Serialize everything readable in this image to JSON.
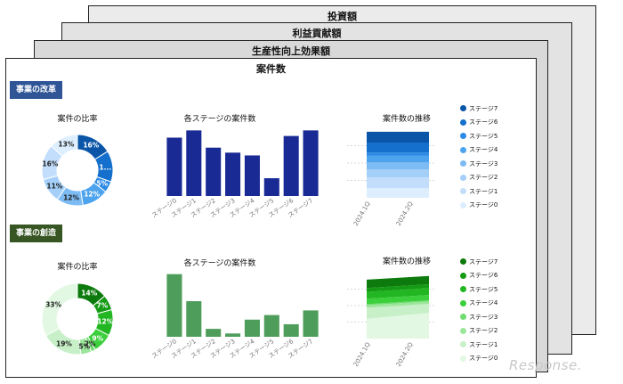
{
  "sheets": {
    "back3": "投資額",
    "back2": "利益貢献額",
    "back1": "生産性向上効果額",
    "front": "案件数"
  },
  "reform": {
    "section_label": "事業の改革",
    "donut_title": "案件の比率",
    "bar_title": "各ステージの案件数",
    "area_title": "案件数の推移"
  },
  "creation": {
    "section_label": "事業の創造",
    "donut_title": "案件の比率",
    "bar_title": "各ステージの案件数",
    "area_title": "案件数の推移"
  },
  "stages": [
    "ステージ0",
    "ステージ1",
    "ステージ2",
    "ステージ3",
    "ステージ4",
    "ステージ5",
    "ステージ6",
    "ステージ7"
  ],
  "legend_order": [
    "ステージ7",
    "ステージ6",
    "ステージ5",
    "ステージ4",
    "ステージ3",
    "ステージ2",
    "ステージ1",
    "ステージ0"
  ],
  "blue_palette": [
    "#ddeeff",
    "#c2defc",
    "#a3cff8",
    "#7cbbf3",
    "#4ea3ee",
    "#2c8ae6",
    "#1470cc",
    "#0a55a8"
  ],
  "green_palette": [
    "#e2f8e2",
    "#c8f0c8",
    "#9be69b",
    "#6fdc6f",
    "#3ccf3c",
    "#22b722",
    "#149a14",
    "#0c7a0c"
  ],
  "bar_color_reform": "#1a2a94",
  "bar_color_creation": "#4f9d5a",
  "area_xticks": [
    "2024.1Q",
    "2024.2Q"
  ],
  "watermark": "Response.",
  "chart_data": [
    {
      "type": "pie",
      "section": "事業の改革",
      "title": "案件の比率",
      "labels": [
        "16%",
        "1...",
        "5%",
        "12%",
        "12%",
        "11%",
        "16%",
        "13%"
      ],
      "values": [
        16,
        14,
        5,
        12,
        12,
        11,
        16,
        13
      ],
      "colors": [
        "#0a55a8",
        "#1470cc",
        "#2c8ae6",
        "#4ea3ee",
        "#7cbbf3",
        "#a3cff8",
        "#c2defc",
        "#ddeeff"
      ]
    },
    {
      "type": "bar",
      "section": "事業の改革",
      "title": "各ステージの案件数",
      "categories": [
        "ステージ0",
        "ステージ1",
        "ステージ2",
        "ステージ3",
        "ステージ4",
        "ステージ5",
        "ステージ6",
        "ステージ7"
      ],
      "values": [
        10.5,
        11.8,
        8.7,
        7.8,
        7.3,
        3.2,
        10.8,
        11.8
      ],
      "ylim": [
        0,
        12.5
      ]
    },
    {
      "type": "area",
      "section": "事業の改革",
      "title": "案件数の推移",
      "x": [
        "2024.1Q",
        "2024.2Q"
      ],
      "series": [
        {
          "name": "ステージ0",
          "values": [
            10.5,
            10.5
          ]
        },
        {
          "name": "ステージ1",
          "values": [
            11.8,
            11.8
          ]
        },
        {
          "name": "ステージ2",
          "values": [
            8.7,
            8.7
          ]
        },
        {
          "name": "ステージ3",
          "values": [
            7.8,
            7.8
          ]
        },
        {
          "name": "ステージ4",
          "values": [
            7.3,
            7.3
          ]
        },
        {
          "name": "ステージ5",
          "values": [
            3.2,
            3.2
          ]
        },
        {
          "name": "ステージ6",
          "values": [
            10.8,
            10.8
          ]
        },
        {
          "name": "ステージ7",
          "values": [
            11.8,
            11.8
          ]
        }
      ]
    },
    {
      "type": "pie",
      "section": "事業の創造",
      "title": "案件の比率",
      "labels": [
        "14%",
        "7%",
        "12%",
        "9%",
        "2%",
        "5%",
        "19%",
        "33%"
      ],
      "values": [
        14,
        7,
        12,
        9,
        2,
        5,
        19,
        33
      ],
      "colors": [
        "#0c7a0c",
        "#149a14",
        "#22b722",
        "#3ccf3c",
        "#6fdc6f",
        "#9be69b",
        "#c8f0c8",
        "#e2f8e2"
      ]
    },
    {
      "type": "bar",
      "section": "事業の創造",
      "title": "各ステージの案件数",
      "categories": [
        "ステージ0",
        "ステージ1",
        "ステージ2",
        "ステージ3",
        "ステージ4",
        "ステージ5",
        "ステージ6",
        "ステージ7"
      ],
      "values": [
        9.5,
        5.4,
        1.2,
        0.5,
        2.6,
        3.3,
        1.9,
        4.0
      ],
      "ylim": [
        0,
        10
      ]
    },
    {
      "type": "area",
      "section": "事業の創造",
      "title": "案件数の推移",
      "x": [
        "2024.1Q",
        "2024.2Q"
      ],
      "series": [
        {
          "name": "ステージ0",
          "values": [
            9.5,
            12.4
          ]
        },
        {
          "name": "ステージ1",
          "values": [
            5.4,
            4.3
          ]
        },
        {
          "name": "ステージ2",
          "values": [
            1.2,
            1.2
          ]
        },
        {
          "name": "ステージ3",
          "values": [
            0.5,
            0.5
          ]
        },
        {
          "name": "ステージ4",
          "values": [
            2.6,
            2.6
          ]
        },
        {
          "name": "ステージ5",
          "values": [
            3.3,
            3.3
          ]
        },
        {
          "name": "ステージ6",
          "values": [
            1.9,
            1.9
          ]
        },
        {
          "name": "ステージ7",
          "values": [
            4.0,
            4.0
          ]
        }
      ]
    }
  ]
}
